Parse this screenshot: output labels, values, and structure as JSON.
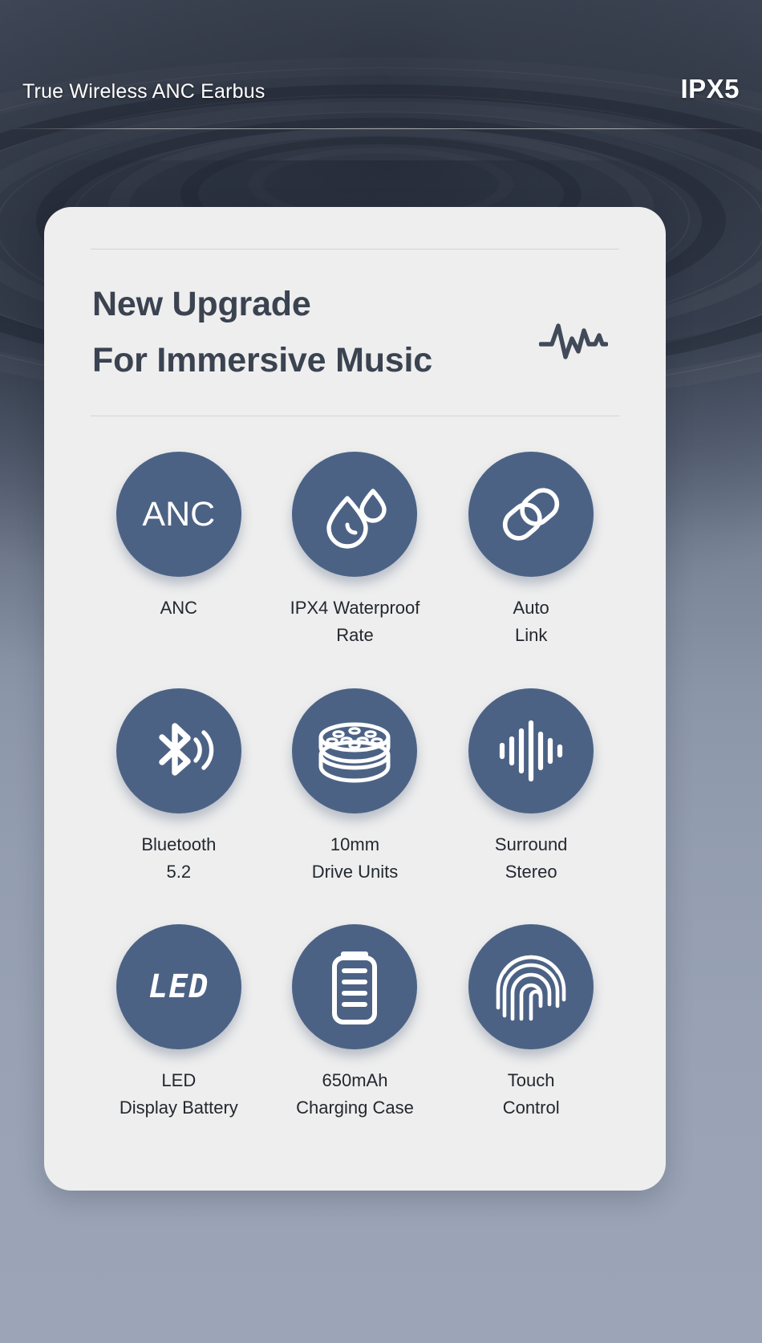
{
  "header": {
    "title": "True Wireless ANC Earbus",
    "badge": "IPX5"
  },
  "card": {
    "headline_line1": "New Upgrade",
    "headline_line2": "For Immersive Music",
    "headline_icon": "pulse-waveform-icon"
  },
  "features": [
    {
      "icon": "anc-text-icon",
      "glyph_text": "ANC",
      "label_line1": "ANC",
      "label_line2": ""
    },
    {
      "icon": "water-drops-icon",
      "glyph_text": "",
      "label_line1": "IPX4 Waterproof",
      "label_line2": "Rate"
    },
    {
      "icon": "chain-link-icon",
      "glyph_text": "",
      "label_line1": "Auto",
      "label_line2": "Link"
    },
    {
      "icon": "bluetooth-icon",
      "glyph_text": "",
      "label_line1": "Bluetooth",
      "label_line2": "5.2"
    },
    {
      "icon": "speaker-driver-icon",
      "glyph_text": "",
      "label_line1": "10mm",
      "label_line2": "Drive Units"
    },
    {
      "icon": "equalizer-icon",
      "glyph_text": "",
      "label_line1": "Surround",
      "label_line2": "Stereo"
    },
    {
      "icon": "led-text-icon",
      "glyph_text": "LED",
      "label_line1": "LED",
      "label_line2": "Display Battery"
    },
    {
      "icon": "battery-icon",
      "glyph_text": "",
      "label_line1": "650mAh",
      "label_line2": "Charging Case"
    },
    {
      "icon": "fingerprint-icon",
      "glyph_text": "",
      "label_line1": "Touch",
      "label_line2": "Control"
    }
  ],
  "colors": {
    "circle_blue": "#4c6285",
    "card_bg": "#eeeeee",
    "headline_text": "#3b4351",
    "caption_text": "#23282f",
    "header_text": "#ffffff"
  }
}
